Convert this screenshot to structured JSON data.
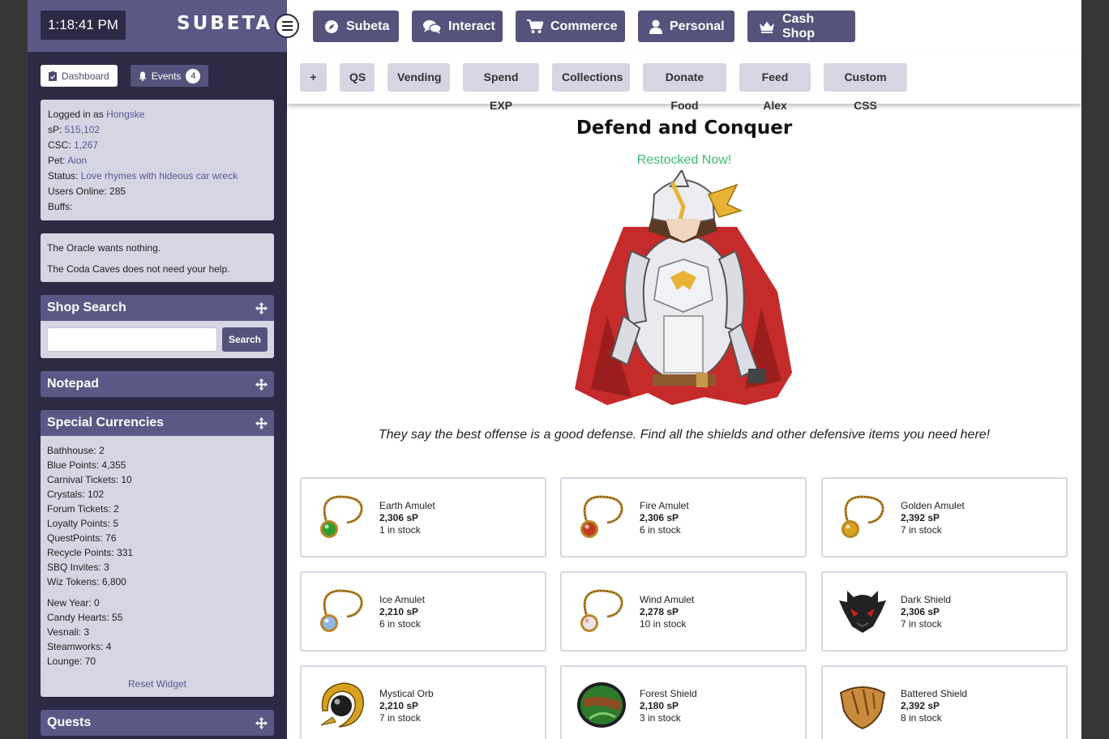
{
  "sidebar": {
    "clock": "1:18:41 PM",
    "brand": "SUBETA",
    "tabs": {
      "dashboard": "Dashboard",
      "events": "Events",
      "events_count": "4"
    },
    "account": {
      "logged_in_prefix": "Logged in as ",
      "username": "Hongske",
      "sp_label": "sP: ",
      "sp_value": "515,102",
      "csc_label": "CSC: ",
      "csc_value": "1,267",
      "pet_label": "Pet: ",
      "pet_value": "Aion",
      "status_label": "Status: ",
      "status_value": "Love rhymes with hideous car wreck",
      "online_label": "Users Online: ",
      "online_value": "285",
      "buffs_label": "Buffs:"
    },
    "oracle": [
      "The Oracle wants nothing.",
      "The Coda Caves does not need your help."
    ],
    "shop_search": {
      "title": "Shop Search",
      "button": "Search",
      "value": ""
    },
    "notepad": {
      "title": "Notepad"
    },
    "special_currencies": {
      "title": "Special Currencies",
      "group1": [
        {
          "label": "Bathhouse:",
          "value": "2"
        },
        {
          "label": "Blue Points:",
          "value": "4,355"
        },
        {
          "label": "Carnival Tickets:",
          "value": "10"
        },
        {
          "label": "Crystals:",
          "value": "102"
        },
        {
          "label": "Forum Tickets:",
          "value": "2"
        },
        {
          "label": "Loyalty Points:",
          "value": "5"
        },
        {
          "label": "QuestPoints:",
          "value": "76"
        },
        {
          "label": "Recycle Points:",
          "value": "331"
        },
        {
          "label": "SBQ Invites:",
          "value": "3"
        },
        {
          "label": "Wiz Tokens:",
          "value": "6,800"
        }
      ],
      "group2": [
        {
          "label": "New Year:",
          "value": "0"
        },
        {
          "label": "Candy Hearts:",
          "value": "55"
        },
        {
          "label": "Vesnali:",
          "value": "3"
        },
        {
          "label": "Steamworks:",
          "value": "4"
        },
        {
          "label": "Lounge:",
          "value": "70"
        }
      ],
      "reset": "Reset Widget"
    },
    "quests": {
      "title": "Quests"
    }
  },
  "nav": {
    "primary": [
      "Subeta",
      "Interact",
      "Commerce",
      "Personal",
      "Cash Shop"
    ],
    "secondary": [
      "+",
      "QS",
      "Vending",
      "Spend EXP",
      "Collections",
      "Donate Food",
      "Feed Alex",
      "Custom CSS"
    ]
  },
  "shop": {
    "title": "Defend and Conquer",
    "restock": "Restocked Now!",
    "description": "They say the best offense is a good defense. Find all the shields and other defensive items you need here!",
    "items": [
      {
        "name": "Earth Amulet",
        "price": "2,306 sP",
        "stock": "1 in stock",
        "icon": "amulet-green-icon",
        "color": "#2f9e2f"
      },
      {
        "name": "Fire Amulet",
        "price": "2,306 sP",
        "stock": "6 in stock",
        "icon": "amulet-red-icon",
        "color": "#c23a1e"
      },
      {
        "name": "Golden Amulet",
        "price": "2,392 sP",
        "stock": "7 in stock",
        "icon": "amulet-gold-icon",
        "color": "#d9a521"
      },
      {
        "name": "Ice Amulet",
        "price": "2,210 sP",
        "stock": "6 in stock",
        "icon": "amulet-ice-icon",
        "color": "#8fb7e8"
      },
      {
        "name": "Wind Amulet",
        "price": "2,278 sP",
        "stock": "10 in stock",
        "icon": "amulet-wind-icon",
        "color": "#efe3e8"
      },
      {
        "name": "Dark Shield",
        "price": "2,306 sP",
        "stock": "7 in stock",
        "icon": "dark-shield-icon",
        "color": "#222222"
      },
      {
        "name": "Mystical Orb",
        "price": "2,210 sP",
        "stock": "7 in stock",
        "icon": "mystical-orb-icon",
        "color": "#d6a21e"
      },
      {
        "name": "Forest Shield",
        "price": "2,180 sP",
        "stock": "3 in stock",
        "icon": "forest-shield-icon",
        "color": "#2d7a2d"
      },
      {
        "name": "Battered Shield",
        "price": "2,392 sP",
        "stock": "8 in stock",
        "icon": "battered-shield-icon",
        "color": "#c98b3c"
      }
    ]
  }
}
